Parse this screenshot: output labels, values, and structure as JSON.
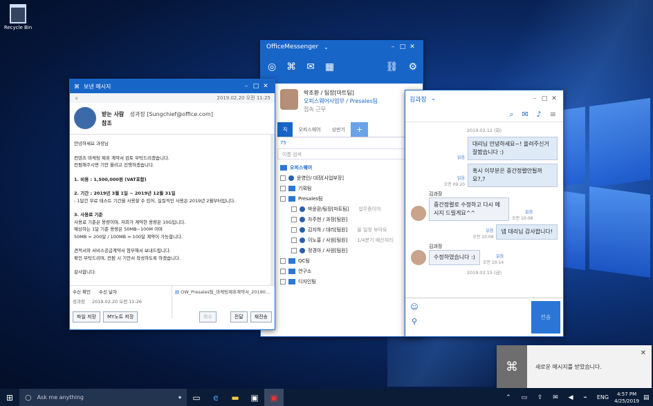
{
  "desktop": {
    "recycle_label": "Recycle Bin"
  },
  "messenger": {
    "title": "OfficeMessenger",
    "name": "박조환 / 팀장[마트팀]",
    "dept": "오피스웨어사업부 / Presales팀",
    "status": "접속 근무",
    "tabs": [
      "직",
      "오피스웨어",
      "상반기"
    ],
    "count": "75",
    "search_placeholder": "이름 검색",
    "tree": [
      {
        "t": "오피스웨어",
        "k": "root"
      },
      {
        "t": "윤영인/ 대장[사업부장]",
        "k": "per"
      },
      {
        "t": "기획팀",
        "k": "fold"
      },
      {
        "t": "Presales팀",
        "k": "fold"
      },
      {
        "t": "박윤환/팀장[마트팀]",
        "k": "per2",
        "note": "업무중이어"
      },
      {
        "t": "차주현 / 과장[팀원]",
        "k": "per2"
      },
      {
        "t": "김지하 / 대리[팀원]",
        "k": "per2",
        "note": "올 일정 보아요"
      },
      {
        "t": "이노홍 / 사원[팀원]",
        "k": "per2",
        "note": "1/4분기 예산처리"
      },
      {
        "t": "정경아 / 사원[팀원]",
        "k": "per2"
      },
      {
        "t": "QC팀",
        "k": "fold"
      },
      {
        "t": "연구소",
        "k": "fold"
      },
      {
        "t": "디자인팀",
        "k": "fold"
      }
    ]
  },
  "note": {
    "title": "보낸 메시지",
    "date": "2019.02.20 오전 11:25",
    "to_label": "받는 사람",
    "to": "성과장 [Sungchief@office.com]",
    "cc_label": "참조",
    "body": [
      "안녕하세요 과장님",
      "",
      "컨텐츠 마케팅 제휴 계약서 검토 부탁드리겠습니다.",
      "컨펌해주시면 기안 올리고 진행하겠습니다.",
      "",
      "1. 비용 : 1,500,000원 (VAT포함)",
      "",
      "2. 기간 : 2019년 3월 1일 ~ 2019년 12월 31일",
      "- 1달간 무료 테스트 기간을 사용할 수 있어, 실질적인 사용은 2019년 2월부터입니다.",
      "",
      "3. 사용료 기준",
      "사용료 기준은 용량이며, 저희가 계약한 용량은 10G입니다.",
      "예상하는 1달 기준 용량은 50MB~100M 이며",
      "50MB = 200달 / 100MB = 100달 계약이 가능합니다.",
      "",
      "견적서와 서비스공급계약서 첨부해서 보내드립니다.",
      "확인 부탁드리며, 컨펌 시 기안서 작성하도록 하겠습니다.",
      "",
      "감사합니다."
    ],
    "read_head": [
      "수신 확인",
      "수신 날자"
    ],
    "read_row": [
      "성과장",
      "2019.02.20 오전 11:26"
    ],
    "attachment": "OW_Presales팀_마케팅제휴계약서_20190...",
    "buttons": [
      "파일 저장",
      "MY노트 저장",
      "회수",
      "전달",
      "재전송"
    ]
  },
  "chat": {
    "title": "김과장",
    "date1": "2019.02.12 (화)",
    "date2": "2019.02.15 (금)",
    "msgs": [
      {
        "who": "me",
        "text": "대리님 안녕하세요~! 올려주신거 잘봤습니다 :)",
        "read": "읽음"
      },
      {
        "who": "me",
        "text": "혹시 이부분은 중간정렬안될까요?,?",
        "read": "읽음",
        "time": "오전 09:20"
      },
      {
        "who": "other",
        "name": "김과장",
        "text": "중간정렬로 수정하고 다시 메시지 드릴게요^^",
        "read": "읽음",
        "time": "오전 10:08"
      },
      {
        "who": "me",
        "text": "넵 대리님 감사합니다!",
        "read": "읽음",
        "time": "오전 10:09"
      },
      {
        "who": "other",
        "name": "김과장",
        "text": "수정하였습니다 :)",
        "read": "읽음",
        "time": "오전 10:14"
      }
    ],
    "send": "전송"
  },
  "toast": {
    "text": "새로운 메시지를 받았습니다."
  },
  "taskbar": {
    "search": "Ask me anything",
    "lang": "ENG",
    "time": "4:57 PM",
    "date": "4/25/2019"
  }
}
